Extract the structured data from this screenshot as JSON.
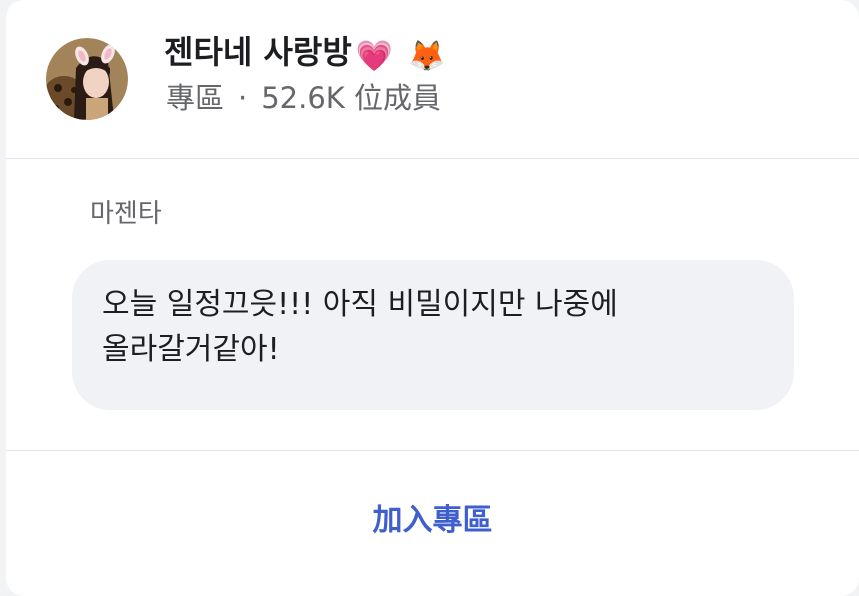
{
  "group": {
    "name": "젠타네 사랑방",
    "emojis": [
      "💗",
      "🦊"
    ],
    "type": "專區",
    "separator": "·",
    "members": "52.6K 位成員",
    "avatar_icon": "group-avatar-photo"
  },
  "post": {
    "author": "마젠타",
    "message": "오늘 일정끄읏!!! 아직 비밀이지만 나중에\n올라갈거같아!"
  },
  "actions": {
    "join_label": "加入專區"
  },
  "colors": {
    "accent": "#3f5fcf",
    "bubble": "#f0f2f5",
    "secondary_text": "#65676b"
  }
}
